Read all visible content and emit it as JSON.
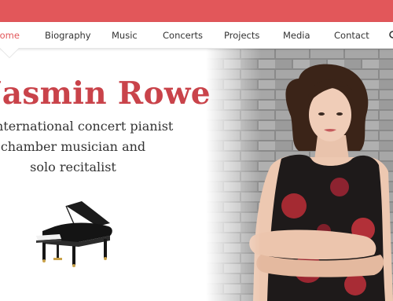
{
  "nav": {
    "items": [
      {
        "label": "Home",
        "active": true
      },
      {
        "label": "Biography",
        "active": false
      },
      {
        "label": "Music",
        "active": false
      },
      {
        "label": "Concerts",
        "active": false
      },
      {
        "label": "Projects",
        "active": false
      },
      {
        "label": "Media",
        "active": false
      },
      {
        "label": "Contact",
        "active": false
      }
    ]
  },
  "hero": {
    "title": "Jasmin Rowe",
    "subtitle_lines": [
      "International concert pianist",
      "chamber musician and",
      "solo recitalist"
    ]
  },
  "colors": {
    "accent": "#e2575a",
    "title": "#c9434a",
    "text": "#333333"
  },
  "icons": {
    "search": "search-icon",
    "piano": "grand-piano-icon"
  }
}
